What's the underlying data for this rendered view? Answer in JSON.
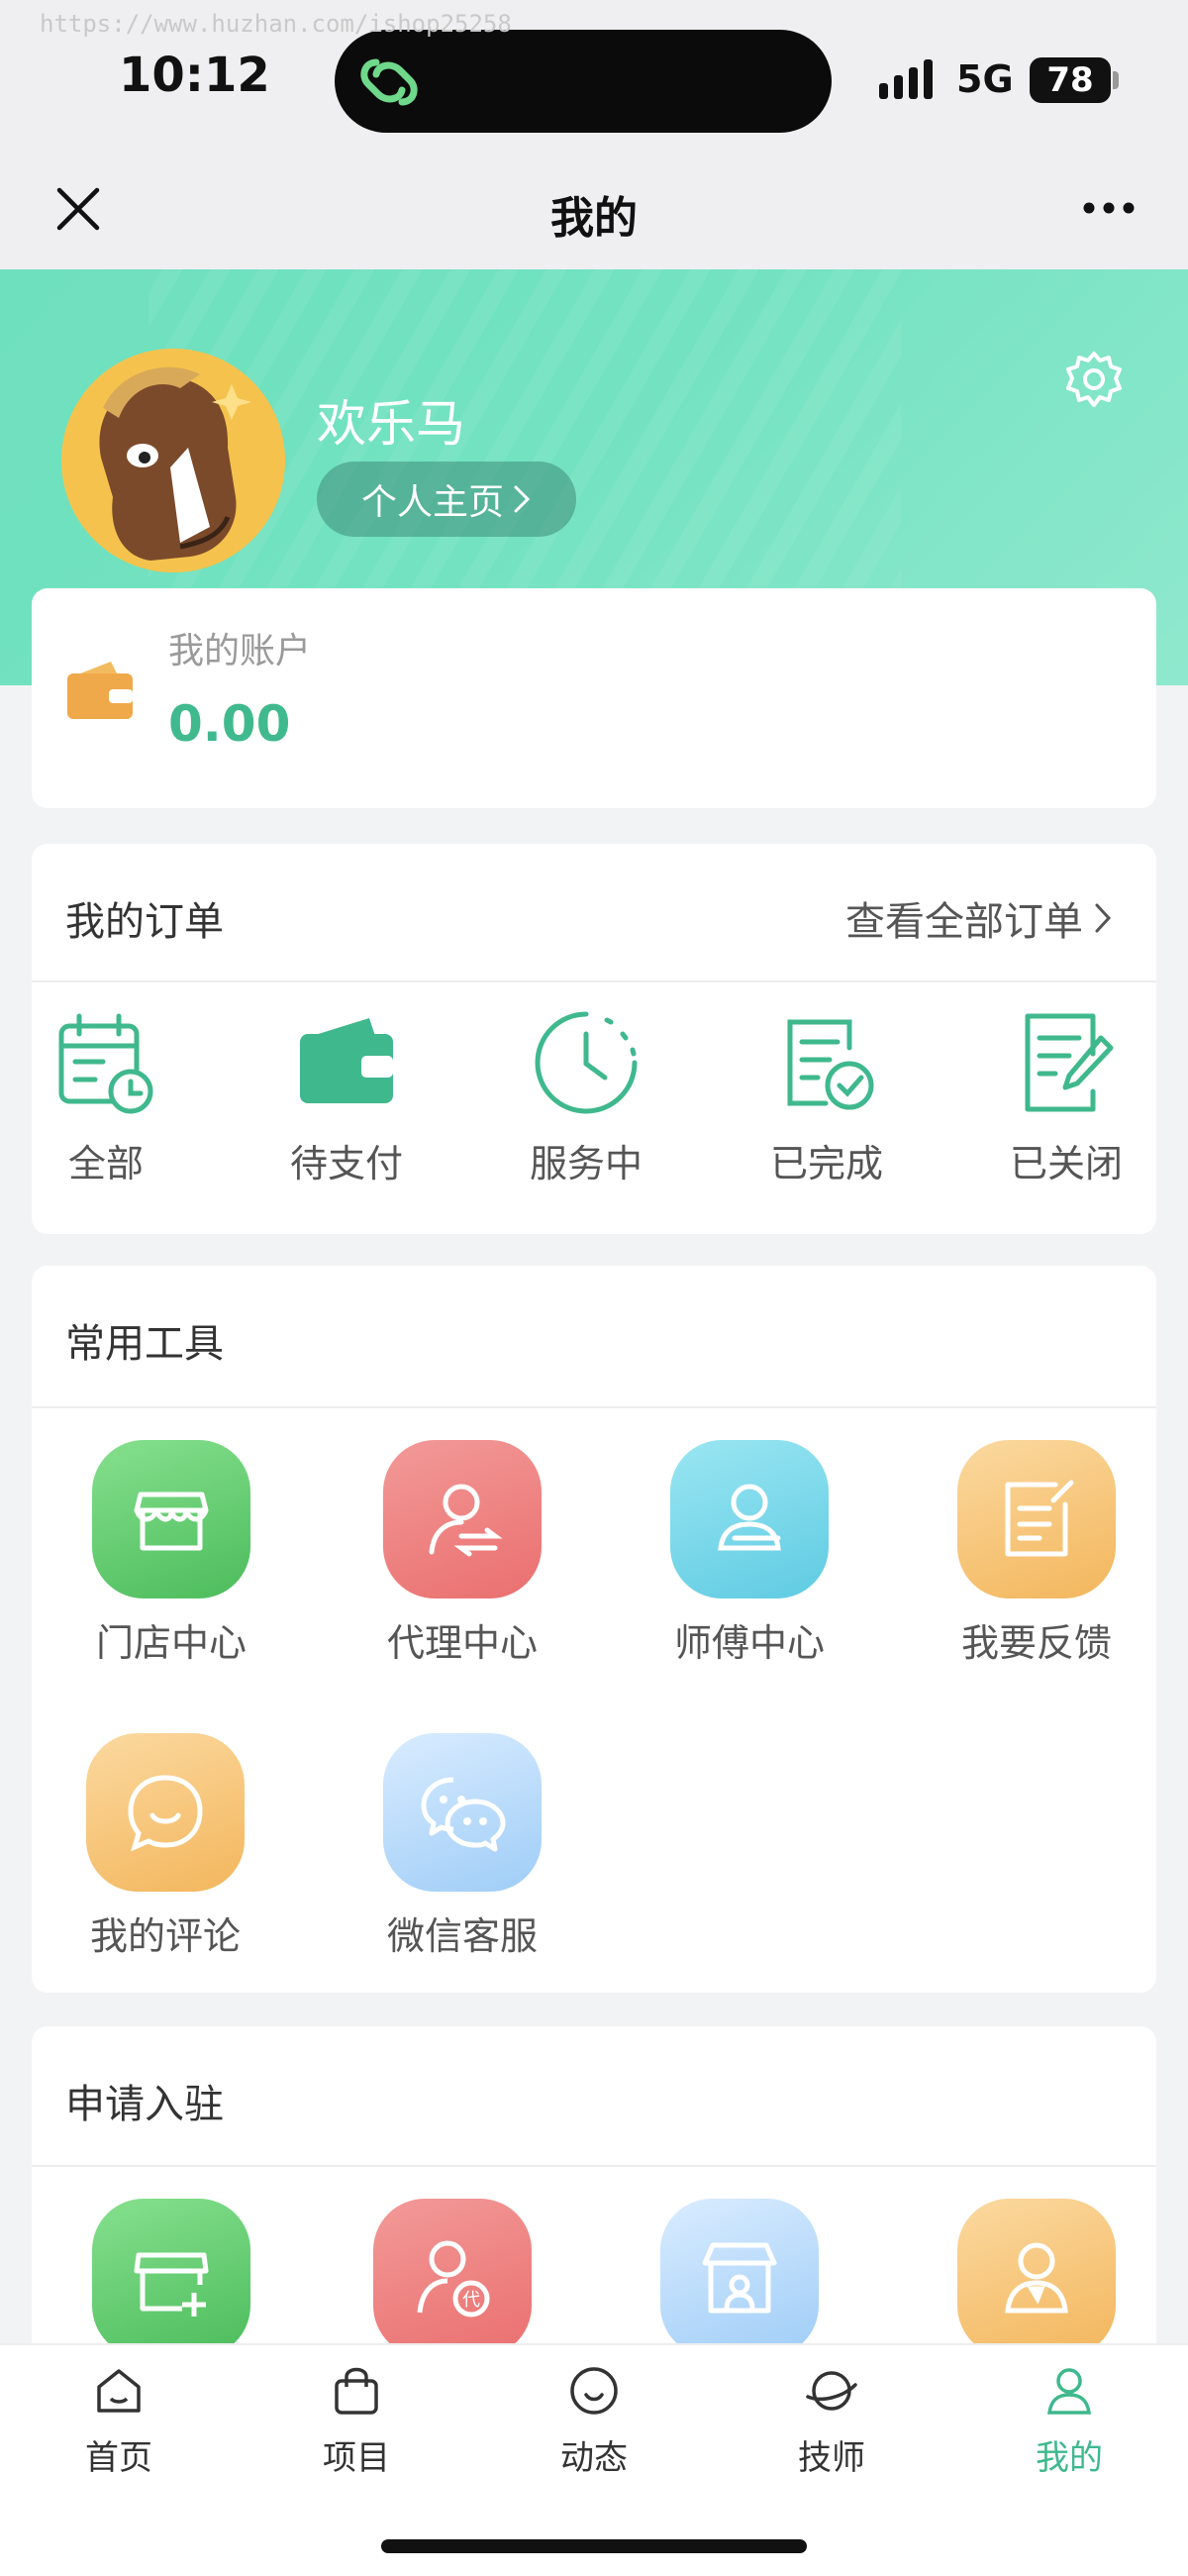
{
  "watermark": "https://www.huzhan.com/ishop25258",
  "status_bar": {
    "time": "10:12",
    "network": "5G",
    "battery": "78"
  },
  "nav": {
    "title": "我的"
  },
  "profile": {
    "username": "欢乐马",
    "homepage_label": "个人主页"
  },
  "account": {
    "label": "我的账户",
    "balance": "0.00"
  },
  "orders": {
    "title": "我的订单",
    "view_all": "查看全部订单",
    "items": [
      {
        "label": "全部",
        "icon": "calendar-clock-icon"
      },
      {
        "label": "待支付",
        "icon": "wallet-icon"
      },
      {
        "label": "服务中",
        "icon": "clock-icon"
      },
      {
        "label": "已完成",
        "icon": "document-check-icon"
      },
      {
        "label": "已关闭",
        "icon": "document-edit-icon"
      }
    ]
  },
  "tools": {
    "title": "常用工具",
    "items": [
      {
        "label": "门店中心",
        "icon": "store-icon"
      },
      {
        "label": "代理中心",
        "icon": "agent-icon"
      },
      {
        "label": "师傅中心",
        "icon": "master-icon"
      },
      {
        "label": "我要反馈",
        "icon": "feedback-icon"
      },
      {
        "label": "我的评论",
        "icon": "comment-icon"
      },
      {
        "label": "微信客服",
        "icon": "wechat-icon"
      }
    ]
  },
  "apply": {
    "title": "申请入驻",
    "items": [
      {
        "icon": "store-add-icon"
      },
      {
        "icon": "agent-badge-icon"
      },
      {
        "icon": "shop-front-icon"
      },
      {
        "icon": "worker-icon"
      }
    ]
  },
  "tabbar": {
    "items": [
      {
        "label": "首页",
        "icon": "home-icon"
      },
      {
        "label": "项目",
        "icon": "bag-icon"
      },
      {
        "label": "动态",
        "icon": "face-icon"
      },
      {
        "label": "技师",
        "icon": "planet-icon"
      },
      {
        "label": "我的",
        "icon": "user-icon",
        "active": true
      }
    ]
  },
  "colors": {
    "accent": "#3fb88d",
    "header": "#72e2c0",
    "wallet": "#efa94a"
  }
}
